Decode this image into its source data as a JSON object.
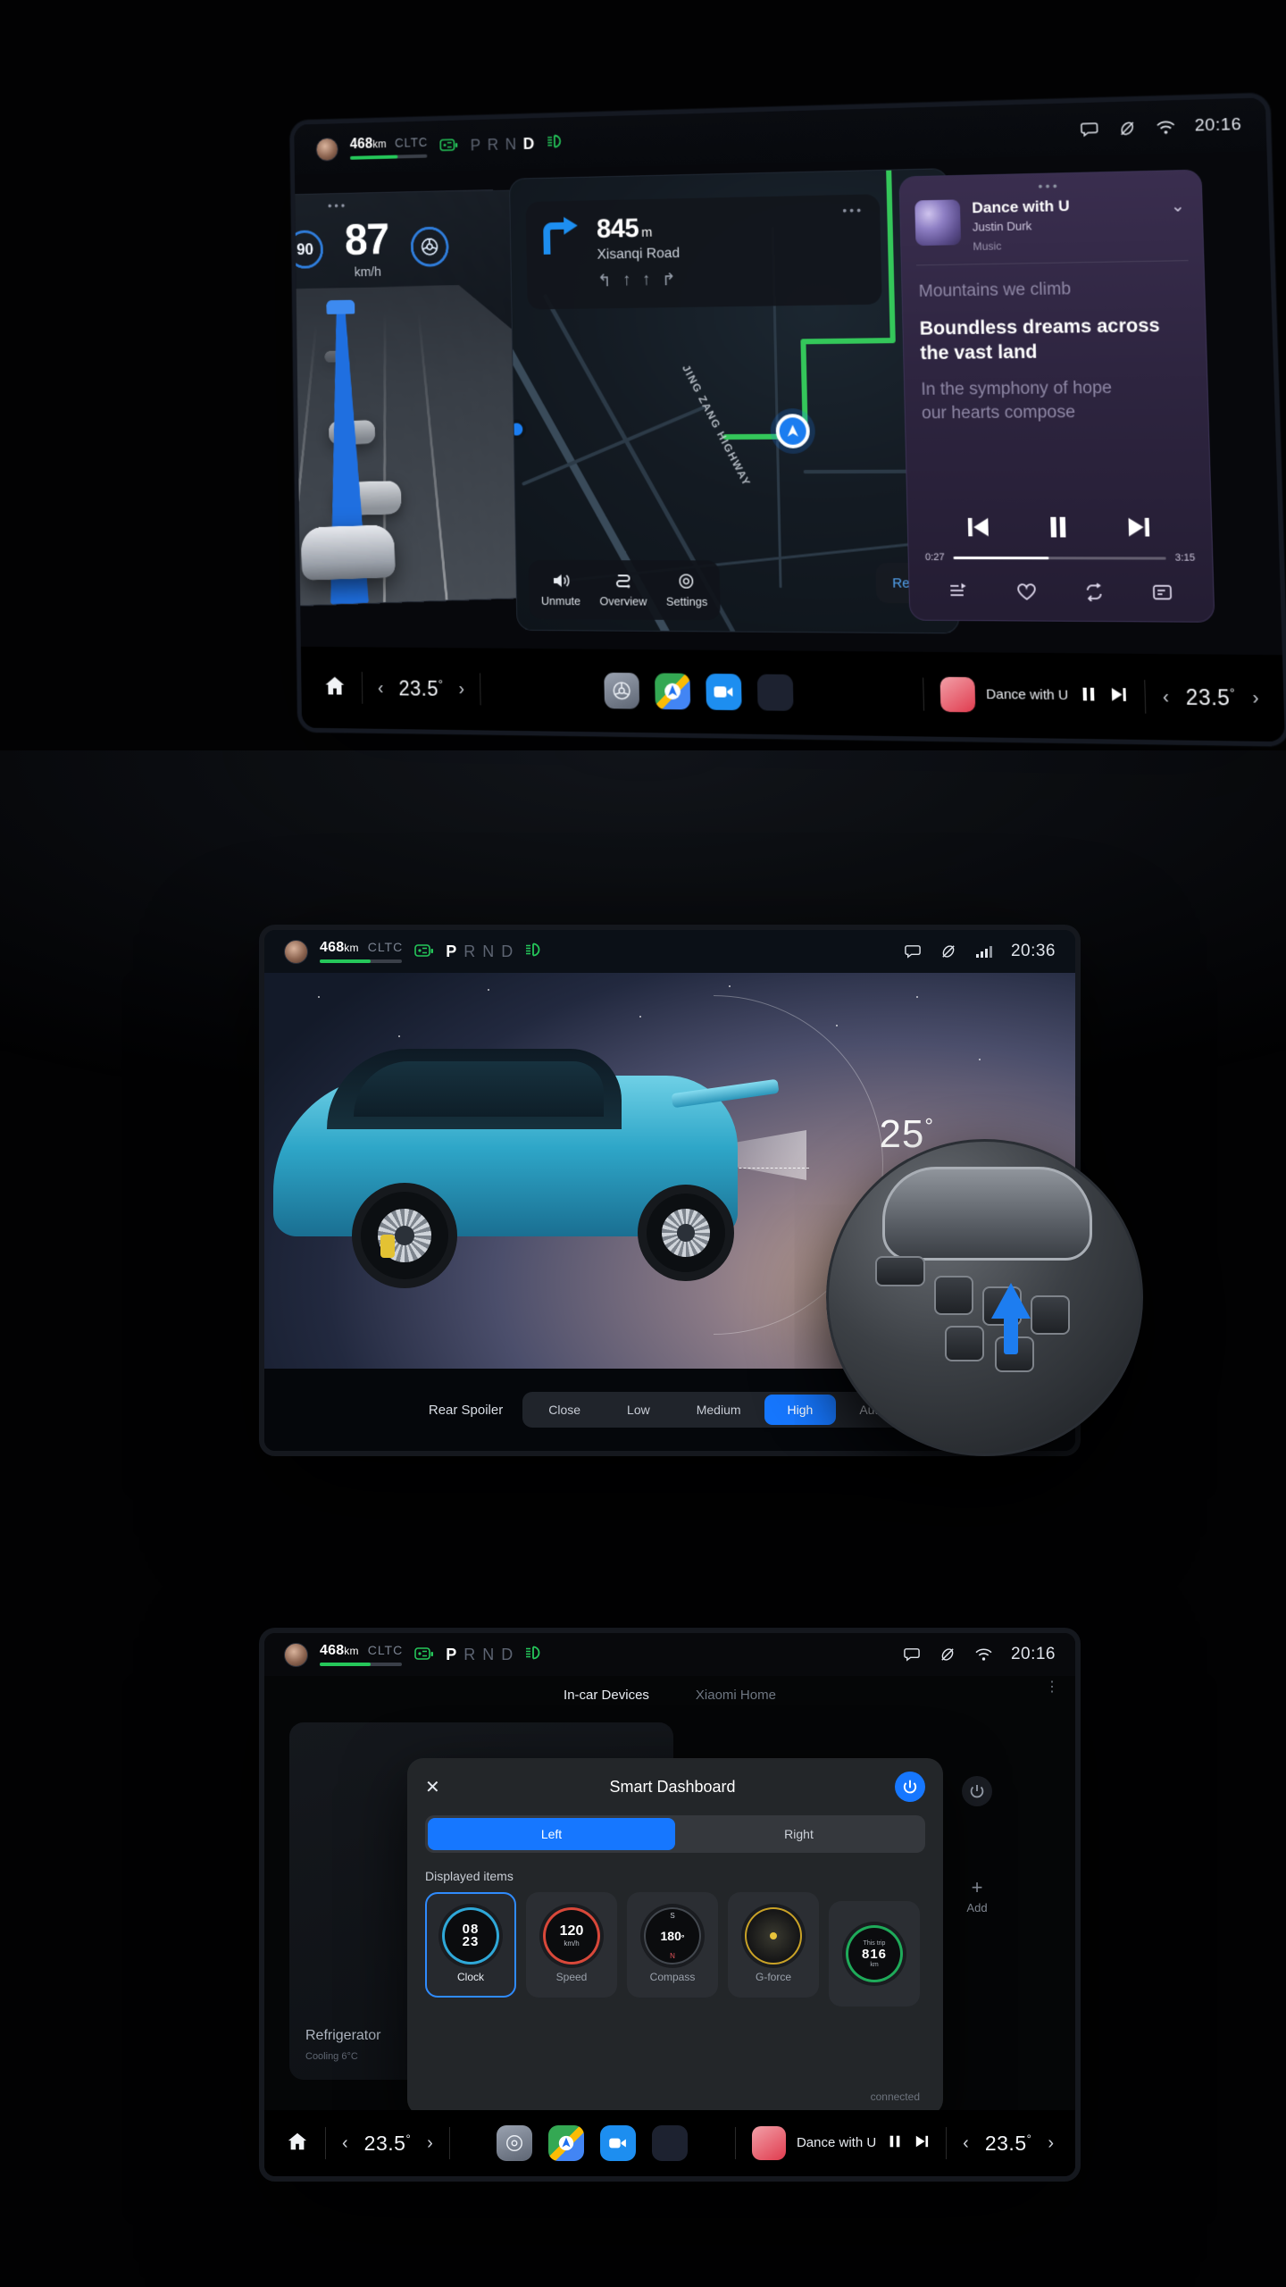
{
  "screen1": {
    "statusbar": {
      "range_value": "468",
      "range_unit": "km",
      "range_standard": "CLTC",
      "battery_icon": "battery-icon",
      "gear_p": "P",
      "gear_r": "R",
      "gear_n": "N",
      "gear_d": "D",
      "headlight_icon": "low-beam-icon",
      "chat_icon": "message-icon",
      "dnd_icon": "do-not-disturb-icon",
      "wifi_icon": "wifi-icon",
      "time": "20:16"
    },
    "cluster": {
      "speed_limit_sign": "90",
      "acc_set_speed": "90",
      "speed": "87",
      "speed_unit": "km/h",
      "assist_icon": "steering-wheel-assist-icon"
    },
    "navigation": {
      "turn_icon": "turn-right-icon",
      "distance": "845",
      "distance_unit": "m",
      "street": "Xisanqi Road",
      "lane_arrows": [
        "↰",
        "↑",
        "↑",
        "↱"
      ],
      "highway_label": "JING ZANG HIGHWAY",
      "tools": [
        {
          "icon": "speaker-mute-icon",
          "label": "Unmute"
        },
        {
          "icon": "route-overview-icon",
          "label": "Overview"
        },
        {
          "icon": "gear-icon",
          "label": "Settings"
        }
      ],
      "recentre_label": "Re-centre"
    },
    "music": {
      "title": "Dance with U",
      "artist": "Justin Durk",
      "source": "Music",
      "collapse_icon": "chevron-down-icon",
      "lyric_prev": "Mountains we climb",
      "lyric_current": "Boundless dreams across the vast land",
      "lyric_next_1": "In the symphony of hope",
      "lyric_next_2": "our hearts compose",
      "elapsed": "0:27",
      "duration": "3:15",
      "progress_percent": 45,
      "controls": [
        "previous-track-icon",
        "pause-icon",
        "next-track-icon"
      ],
      "bottom_actions": [
        "playlist-icon",
        "favourite-heart-icon",
        "repeat-icon",
        "lyrics-icon"
      ]
    },
    "dock": {
      "home_icon": "home-icon",
      "temp_left": "23.5",
      "temp_right": "23.5",
      "temp_unit": "°",
      "apps": [
        "car-settings-icon",
        "maps-icon",
        "camera-icon",
        "app-drawer-icon"
      ],
      "now_playing_title": "Dance with U",
      "pause_icon": "pause-icon",
      "next_icon": "next-track-icon"
    }
  },
  "screen2": {
    "statusbar": {
      "range_value": "468",
      "range_unit": "km",
      "range_standard": "CLTC",
      "gear_p": "P",
      "gear_r": "R",
      "gear_n": "N",
      "gear_d": "D",
      "time": "20:36",
      "chat_icon": "message-icon",
      "dnd_icon": "do-not-disturb-icon",
      "signal_icon": "cellular-signal-icon"
    },
    "angle_readout": "25",
    "angle_unit": "°",
    "spoiler": {
      "label": "Rear Spoiler",
      "options": [
        "Close",
        "Low",
        "Medium",
        "High",
        "Auto"
      ],
      "selected": "High"
    }
  },
  "screen3": {
    "statusbar": {
      "range_value": "468",
      "range_unit": "km",
      "range_standard": "CLTC",
      "gear_p": "P",
      "gear_r": "R",
      "gear_n": "N",
      "gear_d": "D",
      "time": "20:16"
    },
    "tabs": [
      {
        "label": "In-car Devices",
        "active": true
      },
      {
        "label": "Xiaomi Home",
        "active": false
      }
    ],
    "background_card": {
      "label": "Refrigerator",
      "status": "Cooling 6°C"
    },
    "add_label": "Add",
    "connected_label": "connected",
    "dialog": {
      "close_icon": "close-icon",
      "title": "Smart Dashboard",
      "power_icon": "power-icon",
      "side_options": [
        "Left",
        "Right"
      ],
      "side_selected": "Left",
      "section_title": "Displayed items",
      "widgets": [
        {
          "name": "Clock",
          "value_top": "08",
          "value_bottom": "23",
          "selected": true
        },
        {
          "name": "Speed",
          "value": "120",
          "unit": "km/h",
          "selected": false
        },
        {
          "name": "Compass",
          "value": "180",
          "unit": "°",
          "north": "N",
          "south": "S",
          "selected": false
        },
        {
          "name": "G-force",
          "selected": false
        },
        {
          "name": "This trip",
          "value": "816",
          "unit": "km",
          "selected": false
        }
      ]
    },
    "dock": {
      "home_icon": "home-icon",
      "temp_left": "23.5",
      "temp_right": "23.5",
      "temp_unit": "°",
      "now_playing_title": "Dance with U"
    }
  },
  "colors": {
    "accent_blue": "#1677ff",
    "battery_green": "#25c75a",
    "limit_red": "#d9473a",
    "selected_ring": "#2f8bfd"
  }
}
